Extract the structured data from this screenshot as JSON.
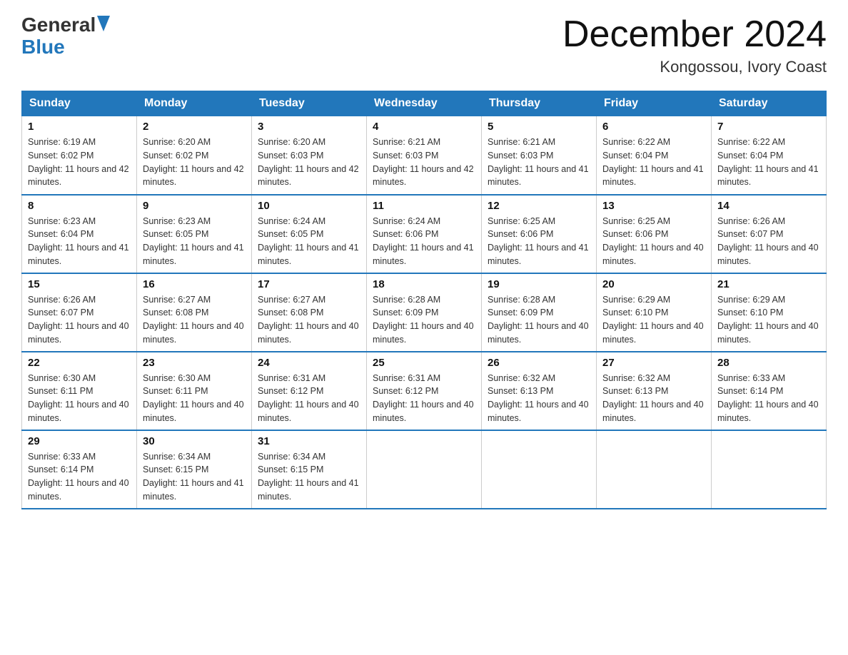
{
  "header": {
    "logo_general": "General",
    "logo_blue": "Blue",
    "month_title": "December 2024",
    "location": "Kongossou, Ivory Coast"
  },
  "days_of_week": [
    "Sunday",
    "Monday",
    "Tuesday",
    "Wednesday",
    "Thursday",
    "Friday",
    "Saturday"
  ],
  "weeks": [
    [
      {
        "num": "1",
        "sunrise": "6:19 AM",
        "sunset": "6:02 PM",
        "daylight": "11 hours and 42 minutes."
      },
      {
        "num": "2",
        "sunrise": "6:20 AM",
        "sunset": "6:02 PM",
        "daylight": "11 hours and 42 minutes."
      },
      {
        "num": "3",
        "sunrise": "6:20 AM",
        "sunset": "6:03 PM",
        "daylight": "11 hours and 42 minutes."
      },
      {
        "num": "4",
        "sunrise": "6:21 AM",
        "sunset": "6:03 PM",
        "daylight": "11 hours and 42 minutes."
      },
      {
        "num": "5",
        "sunrise": "6:21 AM",
        "sunset": "6:03 PM",
        "daylight": "11 hours and 41 minutes."
      },
      {
        "num": "6",
        "sunrise": "6:22 AM",
        "sunset": "6:04 PM",
        "daylight": "11 hours and 41 minutes."
      },
      {
        "num": "7",
        "sunrise": "6:22 AM",
        "sunset": "6:04 PM",
        "daylight": "11 hours and 41 minutes."
      }
    ],
    [
      {
        "num": "8",
        "sunrise": "6:23 AM",
        "sunset": "6:04 PM",
        "daylight": "11 hours and 41 minutes."
      },
      {
        "num": "9",
        "sunrise": "6:23 AM",
        "sunset": "6:05 PM",
        "daylight": "11 hours and 41 minutes."
      },
      {
        "num": "10",
        "sunrise": "6:24 AM",
        "sunset": "6:05 PM",
        "daylight": "11 hours and 41 minutes."
      },
      {
        "num": "11",
        "sunrise": "6:24 AM",
        "sunset": "6:06 PM",
        "daylight": "11 hours and 41 minutes."
      },
      {
        "num": "12",
        "sunrise": "6:25 AM",
        "sunset": "6:06 PM",
        "daylight": "11 hours and 41 minutes."
      },
      {
        "num": "13",
        "sunrise": "6:25 AM",
        "sunset": "6:06 PM",
        "daylight": "11 hours and 40 minutes."
      },
      {
        "num": "14",
        "sunrise": "6:26 AM",
        "sunset": "6:07 PM",
        "daylight": "11 hours and 40 minutes."
      }
    ],
    [
      {
        "num": "15",
        "sunrise": "6:26 AM",
        "sunset": "6:07 PM",
        "daylight": "11 hours and 40 minutes."
      },
      {
        "num": "16",
        "sunrise": "6:27 AM",
        "sunset": "6:08 PM",
        "daylight": "11 hours and 40 minutes."
      },
      {
        "num": "17",
        "sunrise": "6:27 AM",
        "sunset": "6:08 PM",
        "daylight": "11 hours and 40 minutes."
      },
      {
        "num": "18",
        "sunrise": "6:28 AM",
        "sunset": "6:09 PM",
        "daylight": "11 hours and 40 minutes."
      },
      {
        "num": "19",
        "sunrise": "6:28 AM",
        "sunset": "6:09 PM",
        "daylight": "11 hours and 40 minutes."
      },
      {
        "num": "20",
        "sunrise": "6:29 AM",
        "sunset": "6:10 PM",
        "daylight": "11 hours and 40 minutes."
      },
      {
        "num": "21",
        "sunrise": "6:29 AM",
        "sunset": "6:10 PM",
        "daylight": "11 hours and 40 minutes."
      }
    ],
    [
      {
        "num": "22",
        "sunrise": "6:30 AM",
        "sunset": "6:11 PM",
        "daylight": "11 hours and 40 minutes."
      },
      {
        "num": "23",
        "sunrise": "6:30 AM",
        "sunset": "6:11 PM",
        "daylight": "11 hours and 40 minutes."
      },
      {
        "num": "24",
        "sunrise": "6:31 AM",
        "sunset": "6:12 PM",
        "daylight": "11 hours and 40 minutes."
      },
      {
        "num": "25",
        "sunrise": "6:31 AM",
        "sunset": "6:12 PM",
        "daylight": "11 hours and 40 minutes."
      },
      {
        "num": "26",
        "sunrise": "6:32 AM",
        "sunset": "6:13 PM",
        "daylight": "11 hours and 40 minutes."
      },
      {
        "num": "27",
        "sunrise": "6:32 AM",
        "sunset": "6:13 PM",
        "daylight": "11 hours and 40 minutes."
      },
      {
        "num": "28",
        "sunrise": "6:33 AM",
        "sunset": "6:14 PM",
        "daylight": "11 hours and 40 minutes."
      }
    ],
    [
      {
        "num": "29",
        "sunrise": "6:33 AM",
        "sunset": "6:14 PM",
        "daylight": "11 hours and 40 minutes."
      },
      {
        "num": "30",
        "sunrise": "6:34 AM",
        "sunset": "6:15 PM",
        "daylight": "11 hours and 41 minutes."
      },
      {
        "num": "31",
        "sunrise": "6:34 AM",
        "sunset": "6:15 PM",
        "daylight": "11 hours and 41 minutes."
      },
      null,
      null,
      null,
      null
    ]
  ]
}
